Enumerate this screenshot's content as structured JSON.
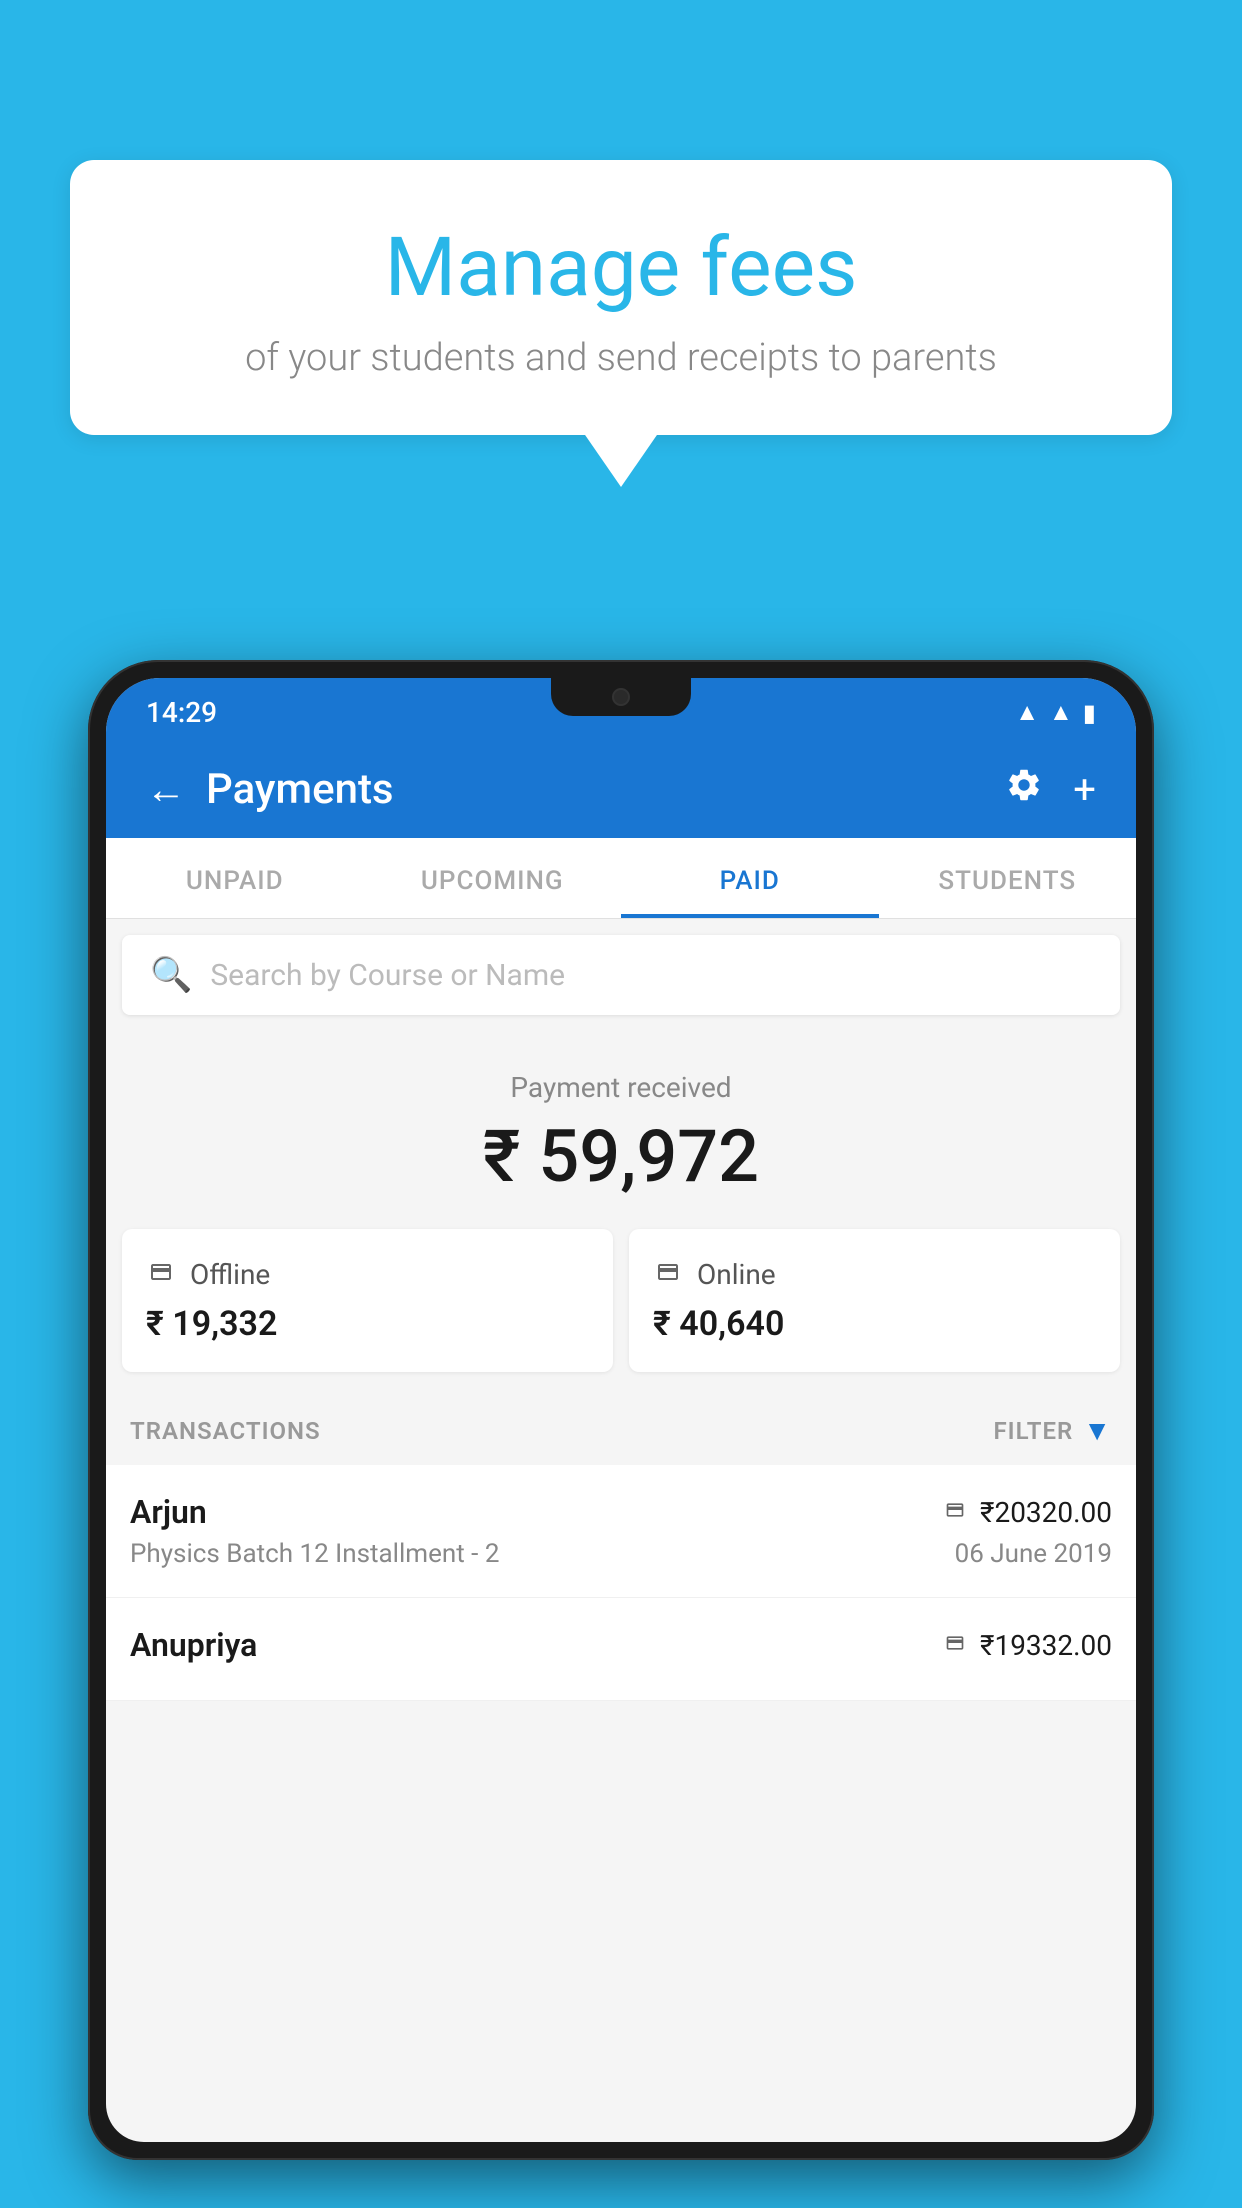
{
  "background_color": "#29B6E8",
  "speech_bubble": {
    "title": "Manage fees",
    "subtitle": "of your students and send receipts to parents"
  },
  "status_bar": {
    "time": "14:29",
    "wifi": "▲",
    "signal": "▲",
    "battery": "▮"
  },
  "header": {
    "title": "Payments",
    "back_label": "←",
    "plus_label": "+"
  },
  "tabs": [
    {
      "label": "UNPAID",
      "active": false
    },
    {
      "label": "UPCOMING",
      "active": false
    },
    {
      "label": "PAID",
      "active": true
    },
    {
      "label": "STUDENTS",
      "active": false
    }
  ],
  "search": {
    "placeholder": "Search by Course or Name"
  },
  "payment_summary": {
    "label": "Payment received",
    "amount": "₹ 59,972"
  },
  "payment_cards": [
    {
      "type": "Offline",
      "amount": "₹ 19,332",
      "icon": "💳"
    },
    {
      "type": "Online",
      "amount": "₹ 40,640",
      "icon": "💳"
    }
  ],
  "transactions_section": {
    "label": "TRANSACTIONS",
    "filter_label": "FILTER"
  },
  "transactions": [
    {
      "name": "Arjun",
      "course": "Physics Batch 12 Installment - 2",
      "amount": "₹20320.00",
      "date": "06 June 2019",
      "payment_type": "online"
    },
    {
      "name": "Anupriya",
      "course": "",
      "amount": "₹19332.00",
      "date": "",
      "payment_type": "offline"
    }
  ]
}
